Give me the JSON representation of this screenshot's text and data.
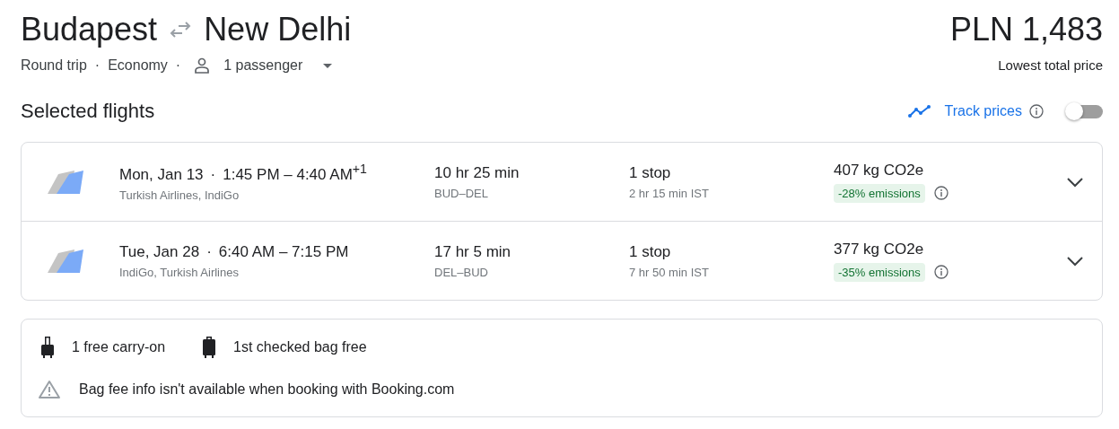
{
  "route": {
    "origin": "Budapest",
    "destination": "New Delhi"
  },
  "trip": {
    "type": "Round trip",
    "separator_1": "·",
    "cabin": "Economy",
    "separator_2": "·",
    "passengers": "1 passenger"
  },
  "price": {
    "amount": "PLN 1,483",
    "label": "Lowest total price"
  },
  "section_title": "Selected flights",
  "track_prices": {
    "label": "Track prices",
    "on": false
  },
  "flights": [
    {
      "date": "Mon, Jan 13",
      "separator": "·",
      "times": "1:45 PM – 4:40 AM$^{+1}$",
      "airlines": "Turkish Airlines, IndiGo",
      "duration": "10 hr 25 min",
      "route": "BUD–DEL",
      "stops": "1 stop",
      "layover": "2 hr 15 min IST",
      "emissions": "407 kg CO2e",
      "emissions_badge": "-28% emissions",
      "expanded": false
    },
    {
      "date": "Tue, Jan 28",
      "separator": "·",
      "times": "6:40 AM – 7:15 PM",
      "airlines": "IndiGo, Turkish Airlines",
      "duration": "17 hr 5 min",
      "route": "DEL–BUD",
      "stops": "1 stop",
      "layover": "7 hr 50 min IST",
      "emissions": "377 kg CO2e",
      "emissions_badge": "-35% emissions",
      "expanded": false
    }
  ],
  "baggage": {
    "items": [
      {
        "kind": "carry-on",
        "text": "1 free carry-on"
      },
      {
        "kind": "checked",
        "text": "1st checked bag free"
      }
    ],
    "warning": "Bag fee info isn't available when booking with Booking.com"
  }
}
